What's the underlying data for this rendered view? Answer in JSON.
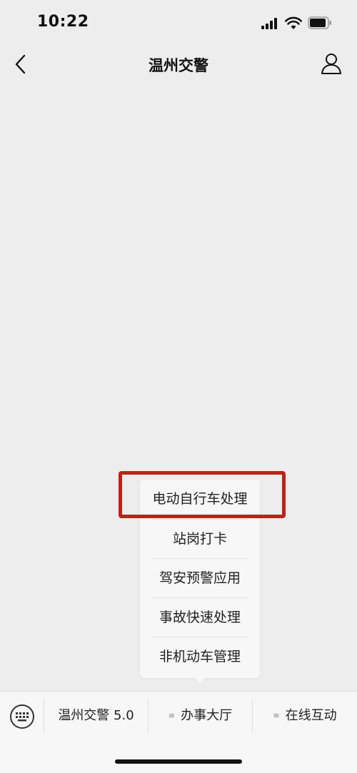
{
  "status_bar": {
    "time": "10:22"
  },
  "nav": {
    "title": "温州交警"
  },
  "popup": {
    "items": [
      {
        "label": "电动自行车处理"
      },
      {
        "label": "站岗打卡"
      },
      {
        "label": "驾安预警应用"
      },
      {
        "label": "事故快速处理"
      },
      {
        "label": "非机动车管理"
      }
    ]
  },
  "bottom_menu": {
    "tabs": [
      {
        "label": "温州交警 5.0"
      },
      {
        "label": "办事大厅",
        "mark": "≡"
      },
      {
        "label": "在线互动",
        "mark": "≡"
      }
    ]
  },
  "colors": {
    "highlight": "#c0211a",
    "background": "#ededed"
  }
}
